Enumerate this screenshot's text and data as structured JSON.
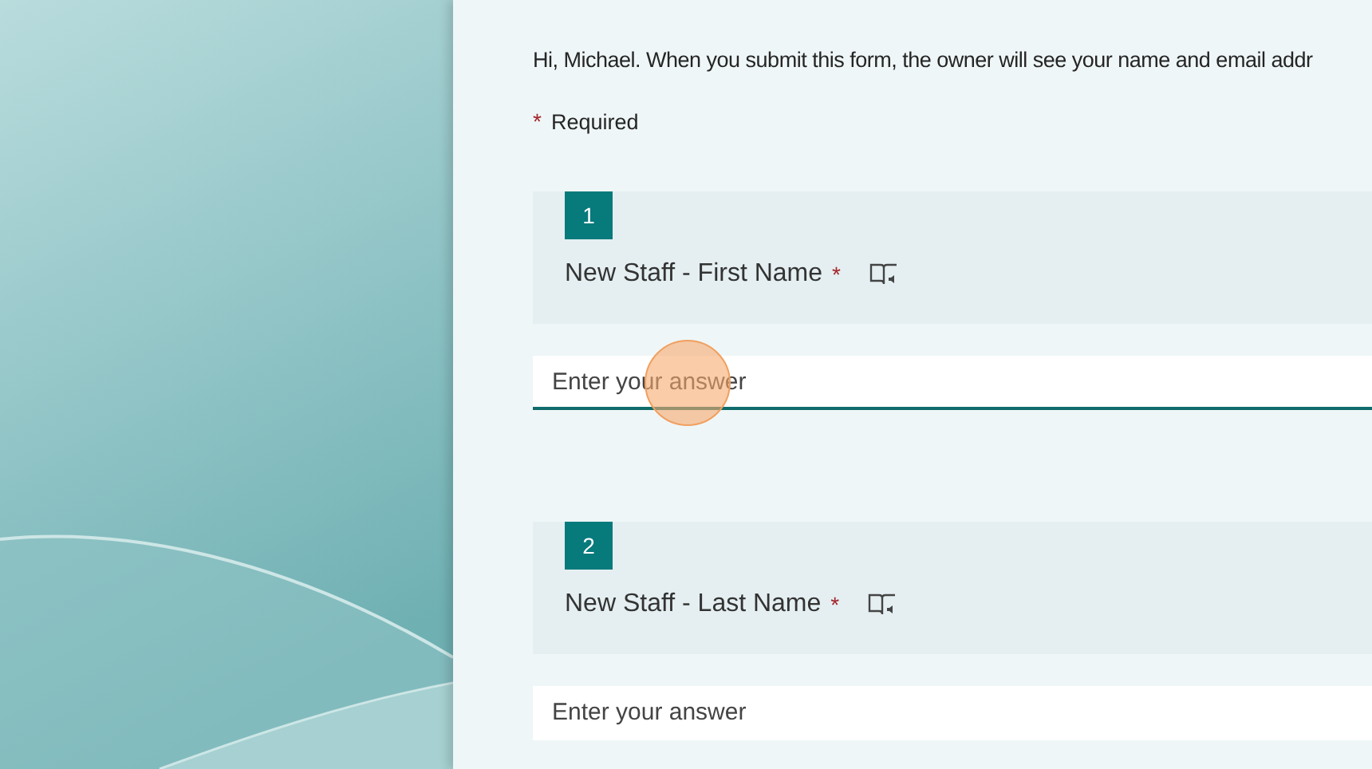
{
  "intro": "Hi, Michael. When you submit this form, the owner will see your name and email addr",
  "required_note": {
    "mark": "*",
    "label": "Required"
  },
  "questions": [
    {
      "number": "1",
      "title": "New Staff - First Name",
      "required": true,
      "answer": {
        "placeholder": "Enter your answer",
        "focused": true,
        "clicked": true
      }
    },
    {
      "number": "2",
      "title": "New Staff - Last Name",
      "required": true,
      "answer": {
        "placeholder": "Enter your answer",
        "focused": false,
        "clicked": false
      }
    }
  ]
}
